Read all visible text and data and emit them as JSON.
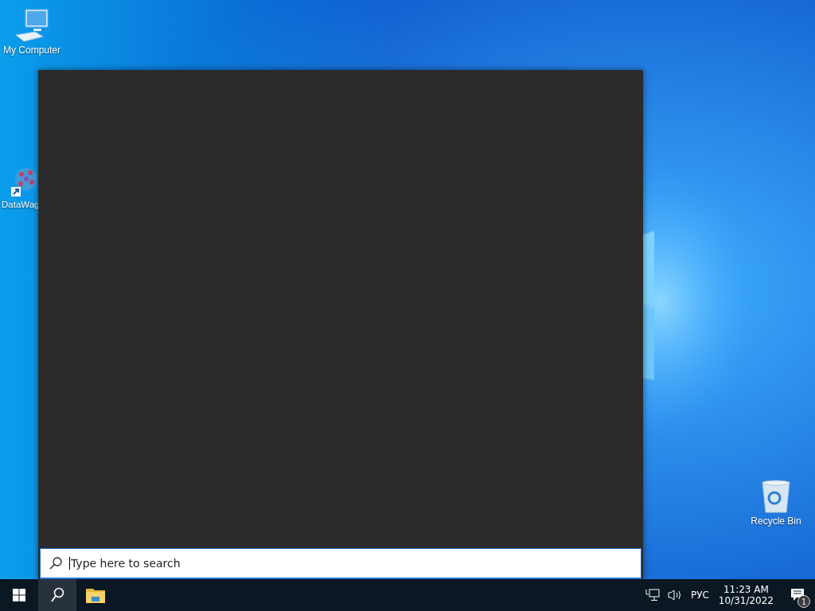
{
  "desktop_icons": [
    {
      "kind": "computer",
      "label": "My Computer"
    },
    {
      "kind": "shortcut",
      "label": "DataWag"
    },
    {
      "kind": "recycle",
      "label": "Recycle Bin"
    }
  ],
  "search_panel": {
    "placeholder": "Type here to search"
  },
  "taskbar": {
    "items": [
      {
        "kind": "start",
        "selected": false
      },
      {
        "kind": "search",
        "selected": true
      },
      {
        "kind": "explorer",
        "selected": false
      }
    ],
    "tray": {
      "language": "РУС",
      "time": "11:23 AM",
      "date": "10/31/2022",
      "notification_count": "1"
    }
  }
}
